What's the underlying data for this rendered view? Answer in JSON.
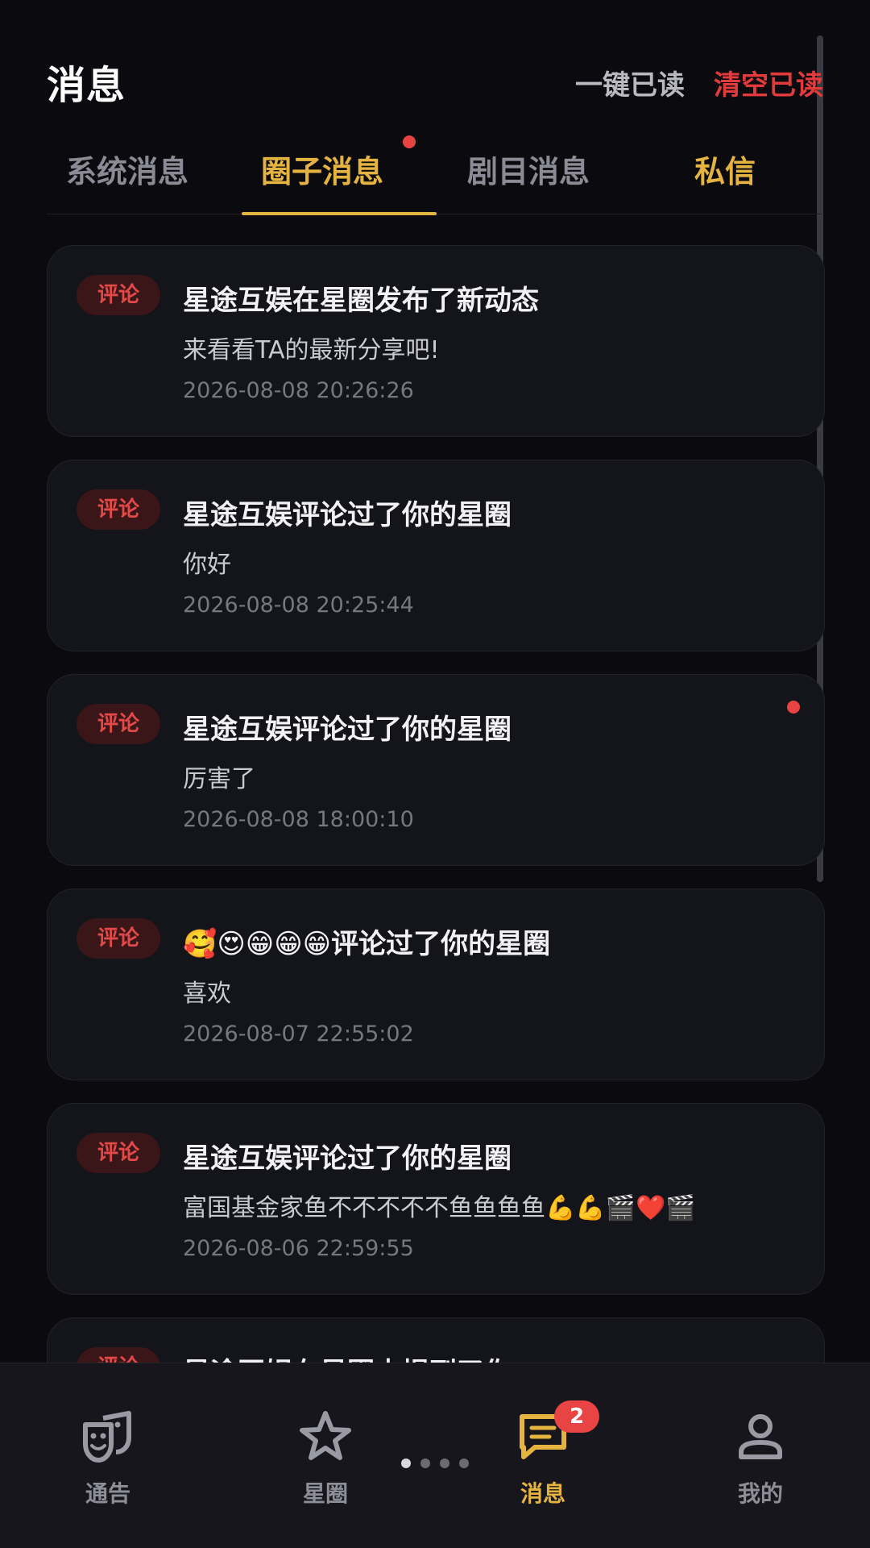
{
  "header": {
    "title": "消息",
    "mark_all_read": "一键已读",
    "clear_read": "清空已读"
  },
  "tabs": [
    {
      "label": "系统消息",
      "active": false,
      "dot": false
    },
    {
      "label": "圈子消息",
      "active": true,
      "dot": true
    },
    {
      "label": "剧目消息",
      "active": false,
      "dot": false
    },
    {
      "label": "私信",
      "active": false,
      "dot": false
    }
  ],
  "messages": [
    {
      "tag": "评论",
      "title": "星途互娱在星圈发布了新动态",
      "body": "来看看TA的最新分享吧!",
      "time": "2026-08-08 20:26:26",
      "unread": false
    },
    {
      "tag": "评论",
      "title": "星途互娱评论过了你的星圈",
      "body": "你好",
      "time": "2026-08-08 20:25:44",
      "unread": false
    },
    {
      "tag": "评论",
      "title": "星途互娱评论过了你的星圈",
      "body": "厉害了",
      "time": "2026-08-08 18:00:10",
      "unread": true
    },
    {
      "tag": "评论",
      "title": "🥰😍😁😁😁评论过了你的星圈",
      "body": "喜欢",
      "time": "2026-08-07 22:55:02",
      "unread": false
    },
    {
      "tag": "评论",
      "title": "星途互娱评论过了你的星圈",
      "body": "富国基金家鱼不不不不不鱼鱼鱼鱼💪💪🎬❤️🎬",
      "time": "2026-08-06 22:59:55",
      "unread": false
    },
    {
      "tag": "评论",
      "title": "星途互娱在星圈中提到了你",
      "body": "",
      "time": "",
      "unread": false
    }
  ],
  "bottom_nav": {
    "items": [
      {
        "label": "通告",
        "icon": "theater-masks-icon",
        "active": false
      },
      {
        "label": "星圈",
        "icon": "star-icon",
        "active": false
      },
      {
        "label": "消息",
        "icon": "message-icon",
        "active": true,
        "badge": "2"
      },
      {
        "label": "我的",
        "icon": "user-icon",
        "active": false
      }
    ],
    "pager": {
      "pages": 4,
      "current": 1
    }
  },
  "colors": {
    "background": "#0b0b0f",
    "card": "#14141b",
    "accent": "#e5b340",
    "danger": "#e84444",
    "tag_bg": "#3a1618"
  }
}
